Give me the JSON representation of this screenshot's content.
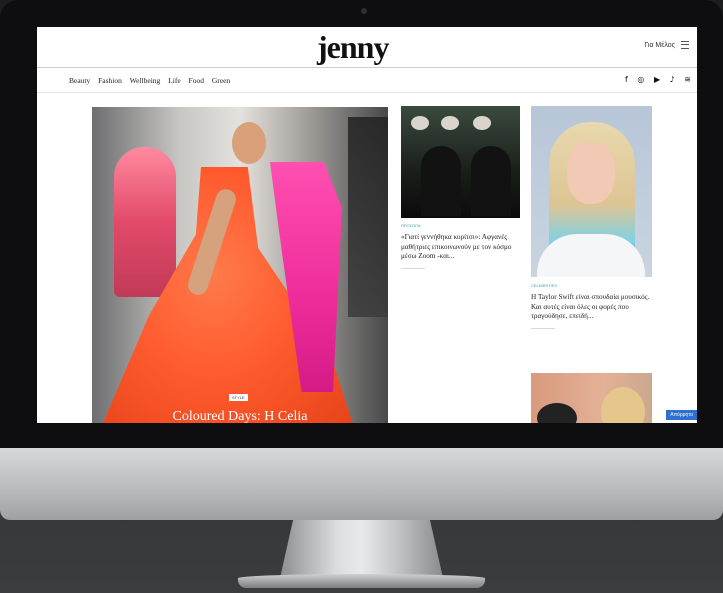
{
  "site": {
    "logo": "jenny",
    "account_label": "Για Μέλος",
    "nav": [
      "Beauty",
      "Fashion",
      "Wellbeing",
      "Life",
      "Food",
      "Green"
    ],
    "social_icons": [
      "facebook-icon",
      "instagram-icon",
      "youtube-icon",
      "tiktok-icon",
      "rss-icon"
    ],
    "social_glyphs": [
      "f",
      "◎",
      "▶",
      "♪",
      "≋"
    ]
  },
  "hero": {
    "tag": "STYLE",
    "title": "Coloured Days: Η Celia"
  },
  "middle": {
    "tag": "ΠΡΟΣΩΠΑ",
    "title": "«Γιατί γεννήθηκα κορίτσι»: Αφγανές μαθήτριες επικοινωνούν με τον κόσμο μέσω Zoom -και..."
  },
  "right": {
    "tag": "CELEBRITIES",
    "title": "Η Taylor Swift είναι σπουδαία μουσικός. Και αυτές είναι όλες οι φορές που τραγούδησε, επειδή..."
  },
  "cookie_label": "Απόρρητο"
}
